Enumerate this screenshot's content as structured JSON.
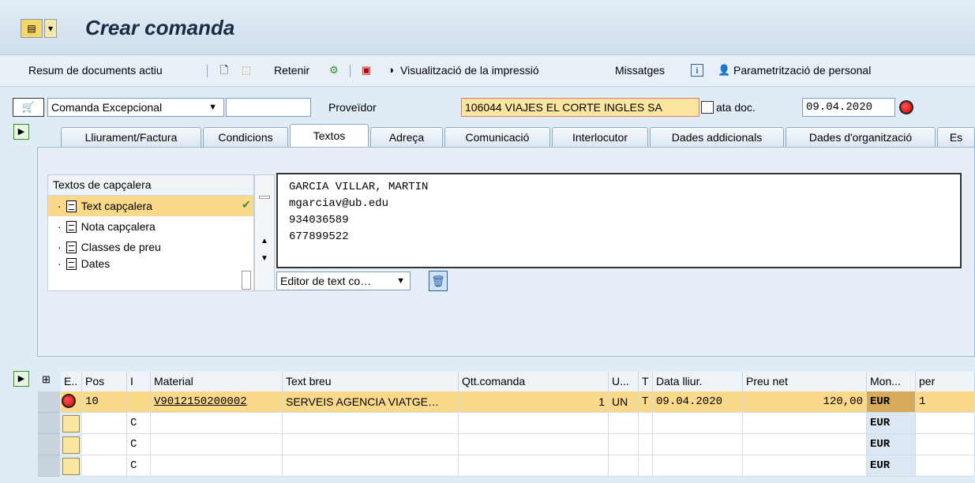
{
  "header": {
    "title": "Crear comanda"
  },
  "toolbar": {
    "resum": "Resum de documents actiu",
    "retenir": "Retenir",
    "visualitzacio": "Visualització de la impressió",
    "missatges": "Missatges",
    "parametritzacio": "Parametrització de personal"
  },
  "doc": {
    "type": "Comanda Excepcional",
    "empty_field": "",
    "vendor_label": "Proveïdor",
    "vendor_value": "106044 VIAJES EL CORTE INGLES SA",
    "date_label": "ata doc.",
    "date_value": "09.04.2020"
  },
  "tabs": [
    "Lliurament/Factura",
    "Condicions",
    "Textos",
    "Adreça",
    "Comunicació",
    "Interlocutor",
    "Dades addicionals",
    "Dades d'organització",
    "Es"
  ],
  "textos": {
    "tree_title": "Textos de capçalera",
    "items": [
      "Text capçalera",
      "Nota capçalera",
      "Classes de preu",
      "Dates"
    ],
    "editor_lines": [
      "GARCIA VILLAR, MARTIN",
      "mgarciav@ub.edu",
      "934036589",
      "677899522"
    ],
    "editor_select": "Editor de text co…"
  },
  "grid": {
    "headers": {
      "e": "E..",
      "pos": "Pos",
      "i": "I",
      "material": "Material",
      "text": "Text breu",
      "qtt": "Qtt.comanda",
      "u": "U...",
      "t": "T",
      "date": "Data lliur.",
      "preu": "Preu net",
      "mon": "Mon...",
      "per": "per"
    },
    "rows": [
      {
        "pos": "10",
        "i": "",
        "material": "V9012150200002",
        "text": "SERVEIS AGENCIA VIATGE…",
        "qtt": "1",
        "u": "UN",
        "t": "T",
        "date": "09.04.2020",
        "preu": "120,00",
        "mon": "EUR",
        "per": "1"
      },
      {
        "pos": "",
        "i": "C",
        "material": "",
        "text": "",
        "qtt": "",
        "u": "",
        "t": "",
        "date": "",
        "preu": "",
        "mon": "EUR",
        "per": ""
      },
      {
        "pos": "",
        "i": "C",
        "material": "",
        "text": "",
        "qtt": "",
        "u": "",
        "t": "",
        "date": "",
        "preu": "",
        "mon": "EUR",
        "per": ""
      },
      {
        "pos": "",
        "i": "C",
        "material": "",
        "text": "",
        "qtt": "",
        "u": "",
        "t": "",
        "date": "",
        "preu": "",
        "mon": "EUR",
        "per": ""
      }
    ]
  }
}
